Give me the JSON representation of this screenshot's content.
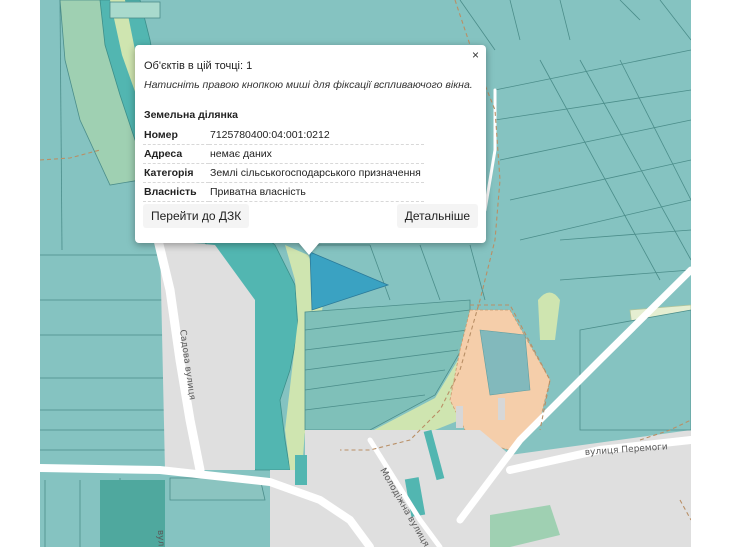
{
  "popup": {
    "close_label": "×",
    "objects_count": "Об'єктів в цій точці: 1",
    "hint": "Натисніть правою кнопкою миші для фіксації вспливаючого вікна.",
    "section_title": "Земельна ділянка",
    "attributes": [
      {
        "key": "Номер",
        "value": "7125780400:04:001:0212"
      },
      {
        "key": "Адреса",
        "value": "немає даних"
      },
      {
        "key": "Категорія",
        "value": "Землі сільськогосподарського призначення"
      },
      {
        "key": "Власність",
        "value": "Приватна власність"
      }
    ],
    "buttons": {
      "go_dzk": "Перейти до ДЗК",
      "details": "Детальніше"
    }
  },
  "map": {
    "street_labels": {
      "sadova": "Садова вулиця",
      "peremohy": "вулиця Перемоги",
      "molodizhna": "Молодіжна вулиця",
      "partial_bottom": "вул"
    },
    "colors": {
      "parcel_fill": "#85c3c1",
      "parcel_stroke": "#4b8d8a",
      "selected_parcel": "#3aa2c2",
      "water": "#52b6b1",
      "road": "#ffffff",
      "meadow": "#cfe5b0",
      "residential": "#dfdfdf",
      "industrial": "#f5ceaa",
      "boundary_dash": "#b98f66"
    }
  }
}
